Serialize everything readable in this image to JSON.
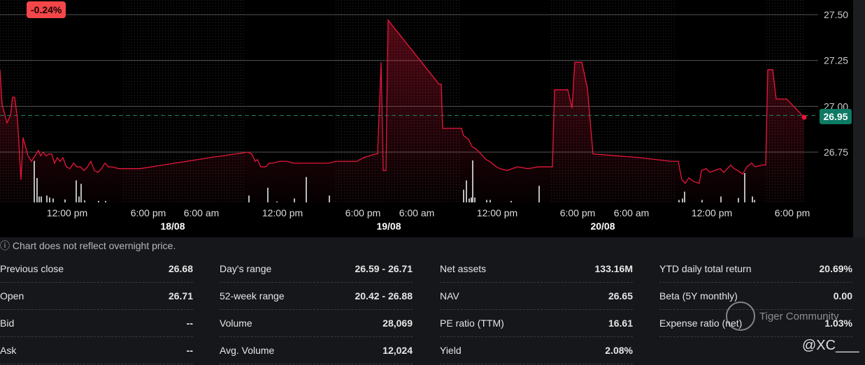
{
  "change_badge": "-0.24%",
  "current_price": "26.95",
  "colors": {
    "line": "#e8173a",
    "badge": "#f4474a",
    "price_tag": "#0e7a63"
  },
  "chart_data": {
    "type": "line",
    "yticks": [
      "27.50",
      "27.25",
      "27.00",
      "26.75"
    ],
    "ylim": [
      26.45,
      27.58
    ],
    "xlim": [
      0,
      1180
    ],
    "reference_price": 26.95,
    "time_labels": [
      {
        "t": 96,
        "label": "12:00 pm"
      },
      {
        "t": 212,
        "label": "6:00 pm"
      },
      {
        "t": 288,
        "label": "6:00 am"
      },
      {
        "t": 404,
        "label": "12:00 pm"
      },
      {
        "t": 519,
        "label": "6:00 pm"
      },
      {
        "t": 596,
        "label": "6:00 am"
      },
      {
        "t": 711,
        "label": "12:00 pm"
      },
      {
        "t": 826,
        "label": "6:00 pm"
      },
      {
        "t": 903,
        "label": "6:00 am"
      },
      {
        "t": 1018,
        "label": "12:00 pm"
      },
      {
        "t": 1133,
        "label": "6:00 pm"
      }
    ],
    "date_labels": [
      {
        "t": 247,
        "label": "18/08"
      },
      {
        "t": 556,
        "label": "19/08"
      },
      {
        "t": 862,
        "label": "20/08"
      }
    ],
    "sessions": [
      [
        47,
        173
      ],
      [
        352,
        480
      ],
      [
        660,
        788
      ],
      [
        968,
        1096
      ]
    ],
    "points": [
      [
        0,
        27.2
      ],
      [
        3,
        27.01
      ],
      [
        10,
        26.91
      ],
      [
        15,
        26.95
      ],
      [
        18,
        27.05
      ],
      [
        21,
        27.05
      ],
      [
        25,
        26.93
      ],
      [
        30,
        26.6
      ],
      [
        33,
        26.83
      ],
      [
        40,
        26.73
      ],
      [
        45,
        26.7
      ],
      [
        50,
        26.73
      ],
      [
        55,
        26.76
      ],
      [
        58,
        26.73
      ],
      [
        62,
        26.75
      ],
      [
        66,
        26.73
      ],
      [
        70,
        26.74
      ],
      [
        74,
        26.74
      ],
      [
        78,
        26.69
      ],
      [
        82,
        26.72
      ],
      [
        86,
        26.7
      ],
      [
        90,
        26.72
      ],
      [
        95,
        26.67
      ],
      [
        100,
        26.66
      ],
      [
        105,
        26.69
      ],
      [
        110,
        26.67
      ],
      [
        115,
        26.67
      ],
      [
        120,
        26.65
      ],
      [
        125,
        26.67
      ],
      [
        130,
        26.7
      ],
      [
        135,
        26.65
      ],
      [
        140,
        26.64
      ],
      [
        145,
        26.66
      ],
      [
        150,
        26.69
      ],
      [
        155,
        26.67
      ],
      [
        160,
        26.67
      ],
      [
        170,
        26.66
      ],
      [
        200,
        26.66
      ],
      [
        300,
        26.72
      ],
      [
        355,
        26.75
      ],
      [
        360,
        26.74
      ],
      [
        365,
        26.7
      ],
      [
        368,
        26.71
      ],
      [
        373,
        26.67
      ],
      [
        380,
        26.67
      ],
      [
        385,
        26.69
      ],
      [
        390,
        26.69
      ],
      [
        400,
        26.7
      ],
      [
        410,
        26.7
      ],
      [
        420,
        26.69
      ],
      [
        450,
        26.69
      ],
      [
        470,
        26.69
      ],
      [
        480,
        26.7
      ],
      [
        510,
        26.7
      ],
      [
        520,
        26.72
      ],
      [
        537,
        26.74
      ],
      [
        540,
        26.74
      ],
      [
        545,
        27.24
      ],
      [
        548,
        26.65
      ],
      [
        552,
        26.65
      ],
      [
        555,
        27.47
      ],
      [
        628,
        27.12
      ],
      [
        631,
        27.12
      ],
      [
        633,
        26.88
      ],
      [
        650,
        26.88
      ],
      [
        660,
        26.88
      ],
      [
        663,
        26.84
      ],
      [
        670,
        26.82
      ],
      [
        675,
        26.78
      ],
      [
        680,
        26.77
      ],
      [
        688,
        26.74
      ],
      [
        695,
        26.71
      ],
      [
        700,
        26.7
      ],
      [
        710,
        26.67
      ],
      [
        715,
        26.66
      ],
      [
        725,
        26.65
      ],
      [
        740,
        26.67
      ],
      [
        755,
        26.66
      ],
      [
        770,
        26.67
      ],
      [
        790,
        26.67
      ],
      [
        793,
        27.09
      ],
      [
        812,
        27.09
      ],
      [
        818,
        26.99
      ],
      [
        822,
        27.24
      ],
      [
        832,
        27.24
      ],
      [
        840,
        27.1
      ],
      [
        848,
        26.74
      ],
      [
        915,
        26.72
      ],
      [
        960,
        26.7
      ],
      [
        970,
        26.7
      ],
      [
        975,
        26.6
      ],
      [
        980,
        26.58
      ],
      [
        985,
        26.61
      ],
      [
        992,
        26.59
      ],
      [
        1000,
        26.58
      ],
      [
        1003,
        26.65
      ],
      [
        1010,
        26.66
      ],
      [
        1015,
        26.64
      ],
      [
        1022,
        26.65
      ],
      [
        1030,
        26.66
      ],
      [
        1035,
        26.64
      ],
      [
        1045,
        26.68
      ],
      [
        1050,
        26.66
      ],
      [
        1055,
        26.65
      ],
      [
        1062,
        26.63
      ],
      [
        1068,
        26.67
      ],
      [
        1075,
        26.69
      ],
      [
        1080,
        26.67
      ],
      [
        1090,
        26.68
      ],
      [
        1095,
        26.68
      ],
      [
        1098,
        27.2
      ],
      [
        1105,
        27.2
      ],
      [
        1110,
        27.04
      ],
      [
        1125,
        27.04
      ],
      [
        1140,
        26.98
      ],
      [
        1150,
        26.94
      ]
    ],
    "volume": [
      [
        48,
        0.85
      ],
      [
        52,
        0.5
      ],
      [
        55,
        0.12
      ],
      [
        58,
        0.12
      ],
      [
        66,
        0.14
      ],
      [
        70,
        0.1
      ],
      [
        75,
        0.08
      ],
      [
        92,
        0.06
      ],
      [
        108,
        0.45
      ],
      [
        112,
        0.12
      ],
      [
        115,
        0.38
      ],
      [
        120,
        0.04
      ],
      [
        140,
        0.03
      ],
      [
        150,
        0.03
      ],
      [
        355,
        0.14
      ],
      [
        382,
        0.3
      ],
      [
        395,
        0.02
      ],
      [
        420,
        0.08
      ],
      [
        437,
        0.52
      ],
      [
        470,
        0.14
      ],
      [
        662,
        0.26
      ],
      [
        666,
        0.45
      ],
      [
        670,
        0.08
      ],
      [
        673,
        0.1
      ],
      [
        675,
        0.86
      ],
      [
        678,
        0.1
      ],
      [
        695,
        0.05
      ],
      [
        700,
        0.05
      ],
      [
        730,
        0.03
      ],
      [
        770,
        0.34
      ],
      [
        970,
        0.05
      ],
      [
        975,
        0.08
      ],
      [
        978,
        0.22
      ],
      [
        1003,
        0.05
      ],
      [
        1030,
        0.12
      ],
      [
        1055,
        0.09
      ],
      [
        1064,
        0.6
      ],
      [
        1075,
        0.12
      ],
      [
        1078,
        0.05
      ]
    ]
  },
  "note": "ⓘ Chart does not reflect overnight price.",
  "stats": [
    [
      {
        "label": "Previous close",
        "value": "26.68"
      },
      {
        "label": "Open",
        "value": "26.71"
      },
      {
        "label": "Bid",
        "value": "--"
      },
      {
        "label": "Ask",
        "value": "--"
      }
    ],
    [
      {
        "label": "Day's range",
        "value": "26.59 - 26.71"
      },
      {
        "label": "52-week range",
        "value": "20.42 - 26.88"
      },
      {
        "label": "Volume",
        "value": "28,069"
      },
      {
        "label": "Avg. Volume",
        "value": "12,024"
      }
    ],
    [
      {
        "label": "Net assets",
        "value": "133.16M"
      },
      {
        "label": "NAV",
        "value": "26.65"
      },
      {
        "label": "PE ratio (TTM)",
        "value": "16.61"
      },
      {
        "label": "Yield",
        "value": "2.08%"
      }
    ],
    [
      {
        "label": "YTD daily total return",
        "value": "20.69%"
      },
      {
        "label": "Beta (5Y monthly)",
        "value": "0.00"
      },
      {
        "label": "Expense ratio (net)",
        "value": "1.03%"
      }
    ]
  ],
  "watermark": {
    "text": "Tiger Community",
    "handle": "@XC___"
  }
}
